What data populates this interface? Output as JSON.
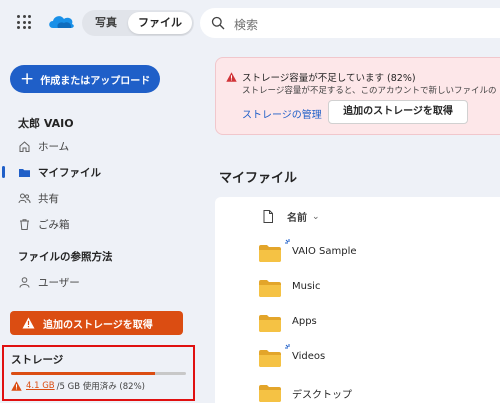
{
  "header": {
    "tabs": [
      {
        "label": "写真"
      },
      {
        "label": "ファイル"
      }
    ],
    "search_placeholder": "検索"
  },
  "sidebar": {
    "create_label": "作成またはアップロード",
    "user_name": "太郎 VAIO",
    "nav": [
      {
        "label": "ホーム"
      },
      {
        "label": "マイファイル"
      },
      {
        "label": "共有"
      },
      {
        "label": "ごみ箱"
      }
    ],
    "browse_title": "ファイルの参照方法",
    "browse_items": [
      {
        "label": "ユーザー"
      }
    ],
    "get_storage_label": "追加のストレージを取得",
    "storage": {
      "title": "ストレージ",
      "used": "4.1 GB",
      "rest": "/5 GB 使用済み (82%)",
      "used_fraction": 0.82
    }
  },
  "banner": {
    "title": "ストレージ容量が不足しています (82%)",
    "description": "ストレージ容量が不足すると、このアカウントで新しいファイルの",
    "manage_link": "ストレージの管理",
    "get_storage_button": "追加のストレージを取得"
  },
  "main": {
    "title": "マイファイル",
    "column_name": "名前",
    "files": [
      {
        "name": "VAIO Sample",
        "new": true
      },
      {
        "name": "Music",
        "new": false
      },
      {
        "name": "Apps",
        "new": false
      },
      {
        "name": "Videos",
        "new": true
      },
      {
        "name": "デスクトップ",
        "new": false
      }
    ]
  },
  "colors": {
    "accent": "#1f5fc8",
    "warning": "#db4d12",
    "folder": "#f5c244"
  }
}
